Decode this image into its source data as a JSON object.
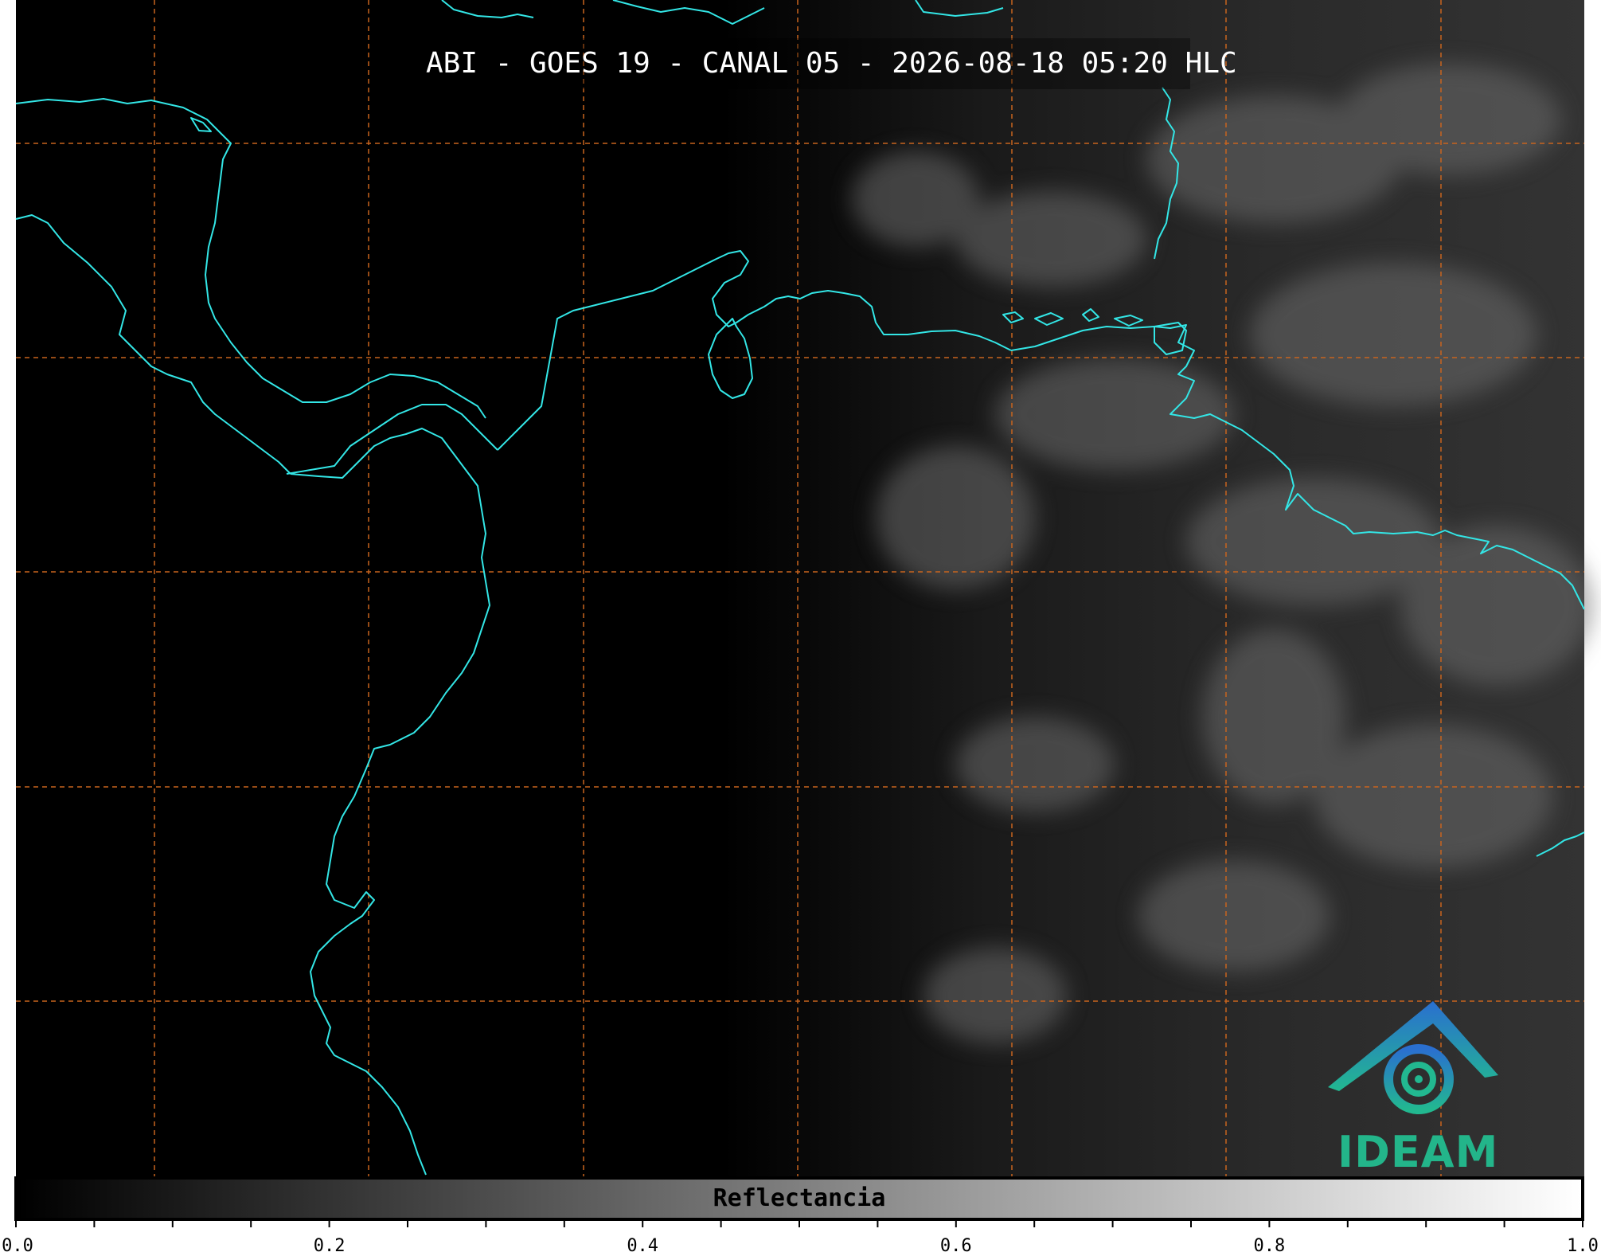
{
  "map": {
    "title": "ABI - GOES 19 - CANAL 05 - 2026-08-18 05:20 HLC",
    "coastline_color": "#33e6e6",
    "gridline_color": "#c8641e",
    "background_color": "#000000"
  },
  "logo": {
    "text": "IDEAM",
    "icon": "ideam-logo-icon",
    "text_color": "#23b58a"
  },
  "colorbar": {
    "label": "Reflectancia",
    "range": [
      0.0,
      1.0
    ],
    "colormap": [
      "#000000",
      "#ffffff"
    ],
    "tick_labels": [
      {
        "value": 0.0,
        "text": "0.0"
      },
      {
        "value": 0.2,
        "text": "0.2"
      },
      {
        "value": 0.4,
        "text": "0.4"
      },
      {
        "value": 0.6,
        "text": "0.6"
      },
      {
        "value": 0.8,
        "text": "0.8"
      },
      {
        "value": 1.0,
        "text": "1.0"
      }
    ],
    "minor_tick_step": 0.05
  }
}
